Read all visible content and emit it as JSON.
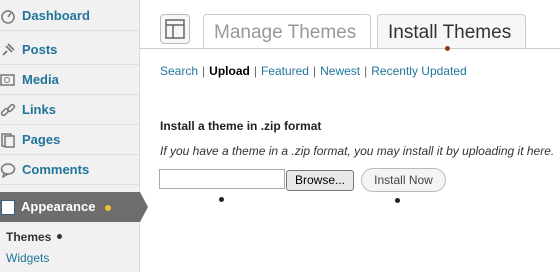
{
  "sidebar": {
    "items": [
      {
        "label": "Dashboard",
        "icon": "dashboard-icon"
      },
      {
        "label": "Posts",
        "icon": "pushpin-icon"
      },
      {
        "label": "Media",
        "icon": "media-icon"
      },
      {
        "label": "Links",
        "icon": "link-icon"
      },
      {
        "label": "Pages",
        "icon": "pages-icon"
      },
      {
        "label": "Comments",
        "icon": "comment-bubble-icon"
      }
    ],
    "active": {
      "label": "Appearance",
      "icon": "appearance-icon"
    },
    "submenu": [
      {
        "label": "Themes"
      },
      {
        "label": "Widgets"
      }
    ]
  },
  "header": {
    "icon": "themes-icon",
    "tabs": [
      {
        "label": "Manage Themes"
      },
      {
        "label": "Install Themes"
      }
    ]
  },
  "subnav": {
    "links": [
      {
        "label": "Search"
      },
      {
        "label": "Upload"
      },
      {
        "label": "Featured"
      },
      {
        "label": "Newest"
      },
      {
        "label": "Recently Updated"
      }
    ],
    "separator": "|"
  },
  "main": {
    "heading": "Install a theme in .zip format",
    "description": "If you have a theme in a .zip format, you may install it by uploading it here.",
    "file_value": "",
    "browse_label": "Browse...",
    "install_label": "Install Now"
  },
  "colors": {
    "link": "#21759b",
    "active_menu": "#6d6d6d",
    "sidebar_bg": "#f1f1f1"
  }
}
